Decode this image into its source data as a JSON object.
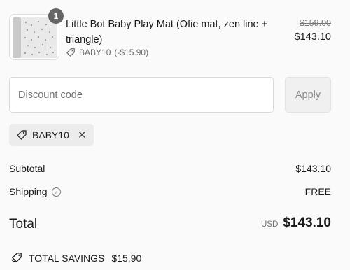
{
  "product": {
    "quantity": "1",
    "title": "Little Bot Baby Play Mat (Ofie mat, zen line + triangle)",
    "discount_code": "BABY10",
    "discount_amount": "(-$15.90)",
    "original_price": "$159.00",
    "price": "$143.10",
    "thumbnail_icon": "play-mat-thumbnail"
  },
  "discount": {
    "placeholder": "Discount code",
    "apply_label": "Apply",
    "applied_code": "BABY10"
  },
  "summary": {
    "subtotal_label": "Subtotal",
    "subtotal_value": "$143.10",
    "shipping_label": "Shipping",
    "shipping_value": "FREE",
    "total_label": "Total",
    "currency": "USD",
    "total_value": "$143.10",
    "savings_label": "TOTAL SAVINGS",
    "savings_value": "$15.90"
  }
}
